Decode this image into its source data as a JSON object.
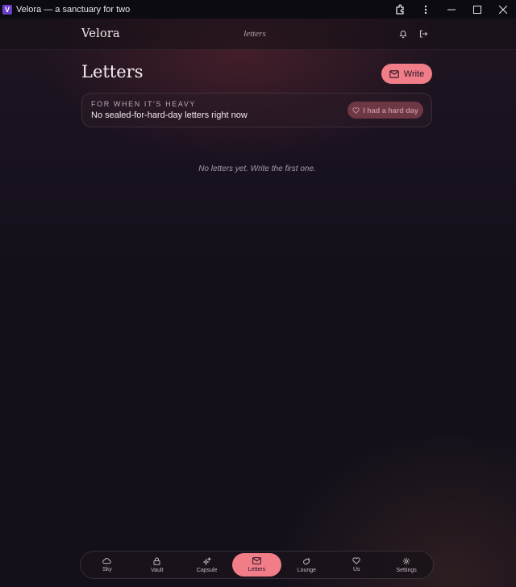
{
  "window": {
    "title": "Velora — a sanctuary for two",
    "app_icon_letter": "V"
  },
  "header": {
    "brand": "Velora",
    "section": "letters",
    "icons": [
      "bell-icon",
      "logout-icon"
    ]
  },
  "page": {
    "title": "Letters",
    "write_label": "Write"
  },
  "heavy_card": {
    "kicker": "FOR WHEN IT'S HEAVY",
    "message": "No sealed-for-hard-day letters right now",
    "button_label": "I had a hard day"
  },
  "empty_state": "No letters yet. Write the first one.",
  "nav": {
    "items": [
      {
        "label": "Sky",
        "icon": "cloud-icon"
      },
      {
        "label": "Vault",
        "icon": "lock-icon"
      },
      {
        "label": "Capsule",
        "icon": "sparkles-icon"
      },
      {
        "label": "Letters",
        "icon": "mail-icon"
      },
      {
        "label": "Lounge",
        "icon": "gamepad-icon"
      },
      {
        "label": "Us",
        "icon": "heart-icon"
      },
      {
        "label": "Settings",
        "icon": "gear-icon"
      }
    ],
    "active": "Letters"
  },
  "colors": {
    "accent": "#f07d87",
    "background": "#14101c",
    "hard_day_button": "#6e3744"
  }
}
